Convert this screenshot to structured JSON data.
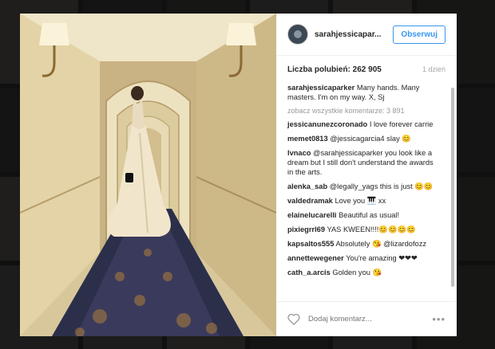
{
  "post": {
    "username": "sarahjessicapar...",
    "follow_label": "Obserwuj",
    "likes_text": "Liczba polubień: 262 905",
    "time": "1 dzień"
  },
  "caption": {
    "user": "sarahjessicaparker",
    "text": "Many hands. Many masters. I'm on my way. X, Sj"
  },
  "view_all": "zobacz wszystkie komentarze: 3 891",
  "comments": [
    {
      "user": "jessicanunezcoronado",
      "text": "I love forever carrie"
    },
    {
      "user": "memet0813",
      "text": "@jessicagarcia4 slay 😊"
    },
    {
      "user": "lvnaco",
      "text": "@sarahjessicaparker you look like a dream but I still don't understand the awards in the arts."
    },
    {
      "user": "alenka_sab",
      "text": "@legally_yags this is just 😊😊"
    },
    {
      "user": "valdedramak",
      "text": "Love you 🎹 xx"
    },
    {
      "user": "elainelucarelli",
      "text": "Beautiful as usual!"
    },
    {
      "user": "pixiegrrl69",
      "text": "YAS KWEEN!!!!😊😊😊😊"
    },
    {
      "user": "kapsaltos555",
      "text": "Absolutely 😘 @lizardofozz"
    },
    {
      "user": "annettewegener",
      "text": "You're amazing ❤❤❤"
    },
    {
      "user": "cath_a.arcis",
      "text": "Golden you 😘"
    }
  ],
  "footer": {
    "placeholder": "Dodaj komentarz...",
    "more": "•••"
  },
  "icons": {
    "heart": "heart-outline-icon",
    "more": "more-options-icon"
  }
}
